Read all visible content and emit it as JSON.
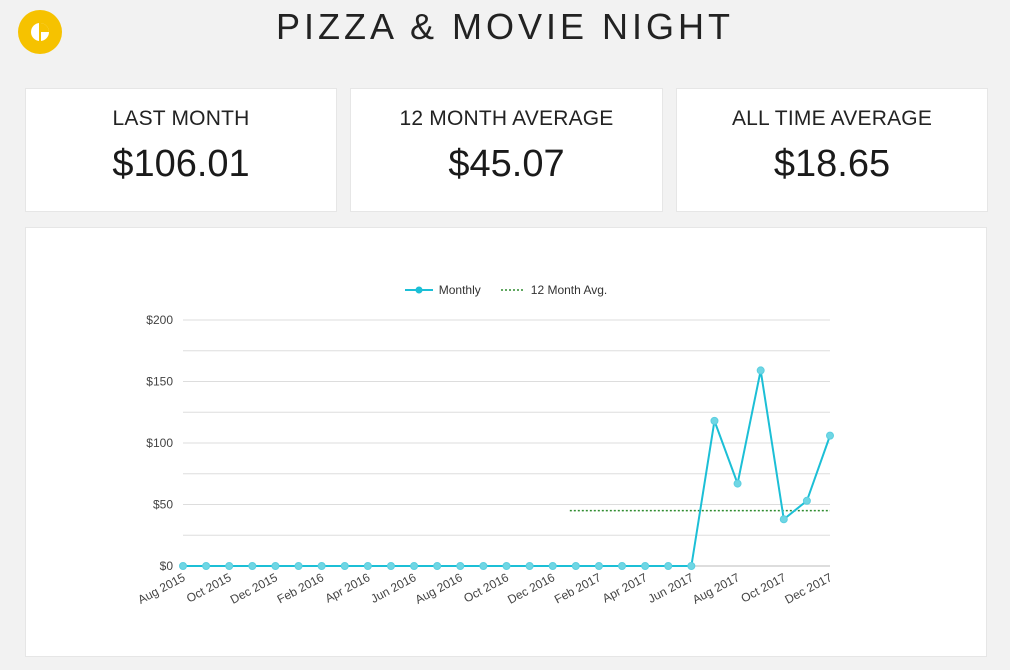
{
  "header": {
    "title": "PIZZA & MOVIE NIGHT",
    "logo_icon": "pie-chart-icon",
    "logo_color": "#f6c200"
  },
  "stats": [
    {
      "label": "LAST MONTH",
      "value": "$106.01"
    },
    {
      "label": "12 MONTH AVERAGE",
      "value": "$45.07"
    },
    {
      "label": "ALL TIME AVERAGE",
      "value": "$18.65"
    }
  ],
  "chart_data": {
    "type": "line",
    "legend_position": "top-center",
    "grid": true,
    "ylim": [
      0,
      200
    ],
    "y_ticks": [
      "$0",
      "$50",
      "$100",
      "$150",
      "$200"
    ],
    "x": [
      "Aug 2015",
      "Sep 2015",
      "Oct 2015",
      "Nov 2015",
      "Dec 2015",
      "Jan 2016",
      "Feb 2016",
      "Mar 2016",
      "Apr 2016",
      "May 2016",
      "Jun 2016",
      "Jul 2016",
      "Aug 2016",
      "Sep 2016",
      "Oct 2016",
      "Nov 2016",
      "Dec 2016",
      "Jan 2017",
      "Feb 2017",
      "Mar 2017",
      "Apr 2017",
      "May 2017",
      "Jun 2017",
      "Jul 2017",
      "Aug 2017",
      "Sep 2017",
      "Oct 2017",
      "Nov 2017",
      "Dec 2017"
    ],
    "x_tick_labels": [
      "Aug 2015",
      "Oct 2015",
      "Dec 2015",
      "Feb 2016",
      "Apr 2016",
      "Jun 2016",
      "Aug 2016",
      "Oct 2016",
      "Dec 2016",
      "Feb 2017",
      "Apr 2017",
      "Jun 2017",
      "Aug 2017",
      "Oct 2017",
      "Dec 2017"
    ],
    "series": [
      {
        "name": "Monthly",
        "color": "#1cbfd6",
        "values": [
          0,
          0,
          0,
          0,
          0,
          0,
          0,
          0,
          0,
          0,
          0,
          0,
          0,
          0,
          0,
          0,
          0,
          0,
          0,
          0,
          0,
          0,
          0,
          118,
          67,
          159,
          38,
          53,
          106
        ]
      },
      {
        "name": "12 Month Avg.",
        "color": "#2e8b2e",
        "style": "dotted",
        "start_index": 17,
        "end_index": 28,
        "value": 45.07
      }
    ]
  }
}
